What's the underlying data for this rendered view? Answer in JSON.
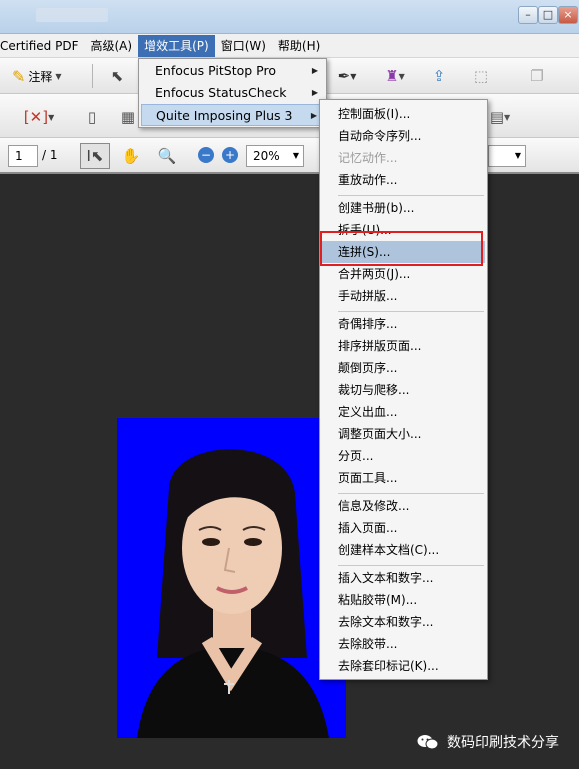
{
  "menubar": {
    "items": [
      {
        "label": "Certified PDF",
        "active": false
      },
      {
        "label": "高级(A)",
        "active": false
      },
      {
        "label": "增效工具(P)",
        "active": true
      },
      {
        "label": "窗口(W)",
        "active": false
      },
      {
        "label": "帮助(H)",
        "active": false
      }
    ]
  },
  "toolbar": {
    "comment_label": "注释",
    "page_current": "1",
    "page_total": "/ 1",
    "zoom_value": "20%"
  },
  "plugins_menu": {
    "items": [
      {
        "label": "Enfocus PitStop Pro"
      },
      {
        "label": "Enfocus StatusCheck"
      },
      {
        "label": "Quite Imposing Plus 3"
      }
    ]
  },
  "qi_menu": {
    "items": [
      {
        "label": "控制面板(I)..."
      },
      {
        "label": "自动命令序列..."
      },
      {
        "label": "记忆动作..."
      },
      {
        "label": "重放动作..."
      },
      {
        "label": "创建书册(b)..."
      },
      {
        "label": "拆手(U)..."
      },
      {
        "label": "连拼(S)..."
      },
      {
        "label": "合并两页(J)..."
      },
      {
        "label": "手动拼版..."
      },
      {
        "label": "奇偶排序..."
      },
      {
        "label": "排序拼版页面..."
      },
      {
        "label": "颠倒页序..."
      },
      {
        "label": "裁切与爬移..."
      },
      {
        "label": "定义出血..."
      },
      {
        "label": "调整页面大小..."
      },
      {
        "label": "分页..."
      },
      {
        "label": "页面工具..."
      },
      {
        "label": "信息及修改..."
      },
      {
        "label": "插入页面..."
      },
      {
        "label": "创建样本文档(C)..."
      },
      {
        "label": "插入文本和数字..."
      },
      {
        "label": "粘贴胶带(M)..."
      },
      {
        "label": "去除文本和数字..."
      },
      {
        "label": "去除胶带..."
      },
      {
        "label": "去除套印标记(K)..."
      }
    ]
  },
  "watermark": {
    "text": "数码印刷技术分享"
  },
  "colors": {
    "menu_active": "#3d6fb5",
    "highlight": "#aec4dd",
    "red_box": "#e02020",
    "photo_bg": "#0000ff"
  }
}
